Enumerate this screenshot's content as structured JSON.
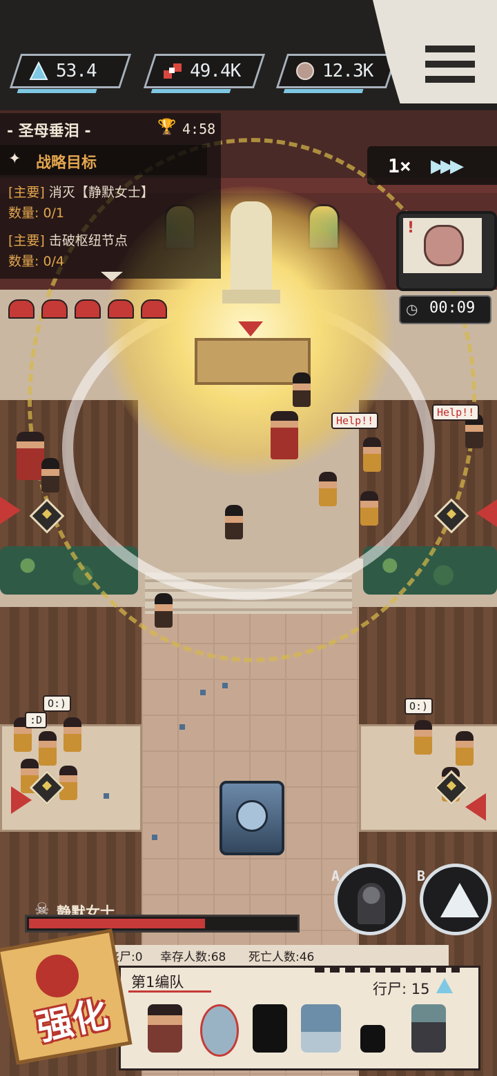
{
  "resources": [
    {
      "icon": "crystal-icon",
      "value": "53.4"
    },
    {
      "icon": "parts-icon",
      "value": "49.4K"
    },
    {
      "icon": "brain-resource-icon",
      "value": "12.3K"
    }
  ],
  "menu": {
    "icon": "hamburger-menu-icon"
  },
  "mission": {
    "title": "- 圣母垂泪 -",
    "timer": "4:58",
    "goal_label": "战略目标",
    "tasks": [
      {
        "tag": "[主要]",
        "text": "消灭【静默女士】",
        "count": "数量: 0/1"
      },
      {
        "tag": "[主要]",
        "text": "击破枢纽节点",
        "count": "数量: 0/4"
      }
    ]
  },
  "speed": {
    "label": "1×"
  },
  "event": {
    "timer": "00:09"
  },
  "scene": {
    "speech_help_1": "Help!!",
    "speech_help_2": "Help!!",
    "speech_smile_1": "O:)",
    "speech_smile_2": "O:)",
    "speech_grin": ":D"
  },
  "boss": {
    "name": "静默女士",
    "health_fraction": 0.66
  },
  "skills": [
    {
      "letter": "A",
      "icon": "fire-skill-icon"
    },
    {
      "letter": "B",
      "icon": "spike-skill-icon"
    }
  ],
  "stats": {
    "zombies": "丧尸:0",
    "survivors": "幸存人数:68",
    "dead": "死亡人数:46"
  },
  "squad": {
    "title": "第1编队",
    "walker_label": "行尸: 15"
  },
  "enhance": {
    "label": "强化"
  },
  "colors": {
    "accent_red": "#c53a36",
    "accent_gold": "#e3a64e",
    "accent_blue": "#7ec8e3"
  }
}
